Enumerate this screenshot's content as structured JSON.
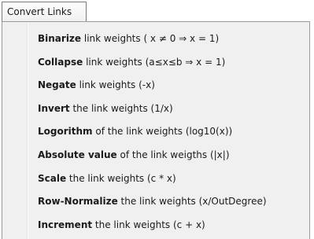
{
  "menu": {
    "title": "Convert Links",
    "items": [
      {
        "bold": "Binarize",
        "rest": " link weights ( x ≠ 0 ⇒ x = 1)"
      },
      {
        "bold": "Collapse",
        "rest": " link weights (a≤x≤b ⇒ x = 1)"
      },
      {
        "bold": "Negate",
        "rest": " link weights (-x)"
      },
      {
        "bold": "Invert",
        "rest": " the link weights (1/x)"
      },
      {
        "bold": "Logorithm",
        "rest": " of the link weights (log10(x))"
      },
      {
        "bold": "Absolute value",
        "rest": " of the link weigths (|x|)"
      },
      {
        "bold": "Scale",
        "rest": " the link weights (c * x)"
      },
      {
        "bold": "Row-Normalize",
        "rest": " the link weights (x/OutDegree)"
      },
      {
        "bold": "Increment",
        "rest": " the link weights (c + x)"
      }
    ]
  }
}
